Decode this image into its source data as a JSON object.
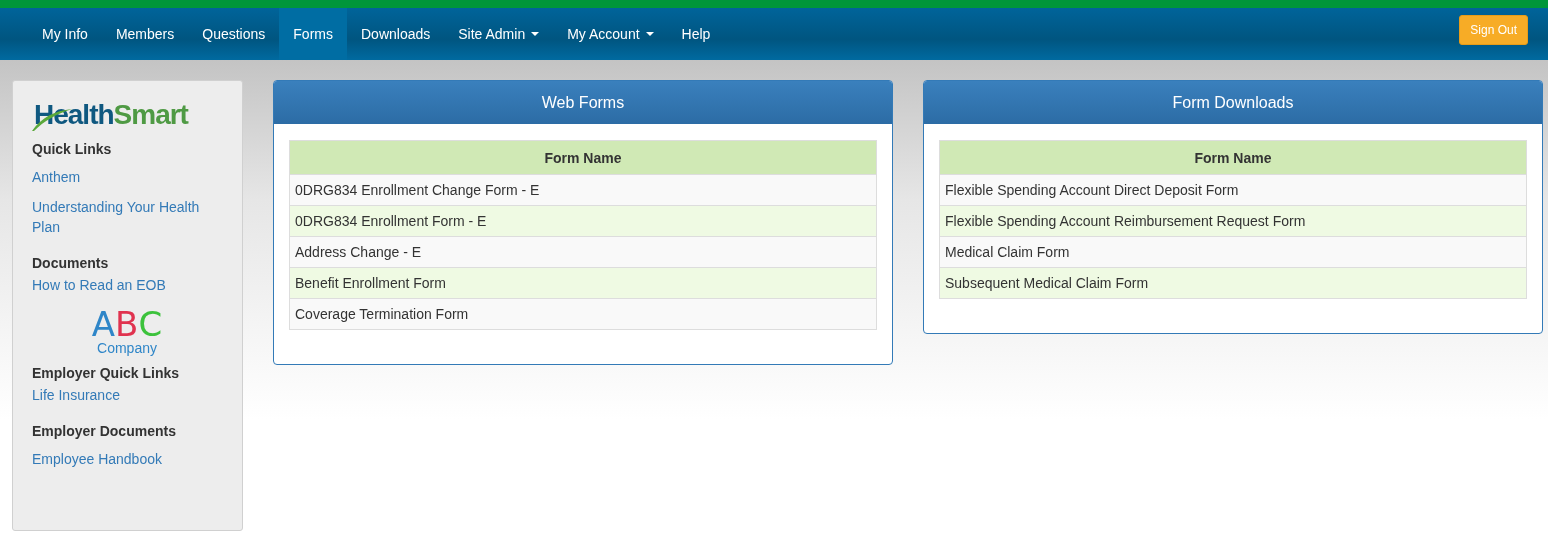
{
  "nav": {
    "items": [
      {
        "label": "My Info",
        "selected": false,
        "dropdown": false
      },
      {
        "label": "Members",
        "selected": false,
        "dropdown": false
      },
      {
        "label": "Questions",
        "selected": false,
        "dropdown": false
      },
      {
        "label": "Forms",
        "selected": true,
        "dropdown": false
      },
      {
        "label": "Downloads",
        "selected": false,
        "dropdown": false
      },
      {
        "label": "Site Admin",
        "selected": false,
        "dropdown": true
      },
      {
        "label": "My Account",
        "selected": false,
        "dropdown": true
      },
      {
        "label": "Help",
        "selected": false,
        "dropdown": false
      }
    ],
    "sign_out": "Sign Out"
  },
  "sidebar": {
    "logo": {
      "first": "Health",
      "second": "Smart"
    },
    "sections": [
      {
        "kind": "links",
        "heading": "Quick Links",
        "spaced": true,
        "links": [
          "Anthem",
          "Understanding Your Health Plan"
        ]
      },
      {
        "kind": "links",
        "heading": "Documents",
        "spaced": false,
        "links": [
          "How to Read an EOB"
        ]
      },
      {
        "kind": "logo",
        "letters": [
          {
            "text": "A",
            "color": "#2f86c8"
          },
          {
            "text": "B",
            "color": "#e0334f"
          },
          {
            "text": "C",
            "color": "#3cc23c"
          }
        ],
        "caption": "Company"
      },
      {
        "kind": "links",
        "heading": "Employer Quick Links",
        "spaced": false,
        "links": [
          "Life Insurance"
        ]
      },
      {
        "kind": "links",
        "heading": "Employer Documents",
        "spaced": true,
        "links": [
          "Employee Handbook"
        ]
      }
    ]
  },
  "panels": [
    {
      "title": "Web Forms",
      "column": "Form Name",
      "rows": [
        "0DRG834 Enrollment Change Form - E",
        "0DRG834 Enrollment Form - E",
        "Address Change - E",
        "Benefit Enrollment Form",
        "Coverage Termination Form"
      ]
    },
    {
      "title": "Form Downloads",
      "column": "Form Name",
      "rows": [
        "Flexible Spending Account Direct Deposit Form",
        "Flexible Spending Account Reimbursement Request Form",
        "Medical Claim Form",
        "Subsequent Medical Claim Form"
      ]
    }
  ]
}
